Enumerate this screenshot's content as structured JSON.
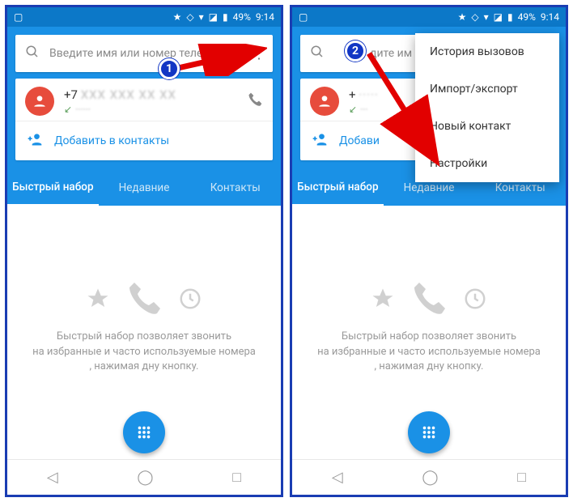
{
  "statusbar": {
    "battery": "49%",
    "time": "9:14"
  },
  "search": {
    "placeholder": "Введите имя или номер телеф",
    "placeholder_cut": "дите им"
  },
  "recent": {
    "number_prefix": "+7",
    "number_prefix2": "+",
    "number_blur": "XXX XXX XX XX",
    "incoming_mark": "↙",
    "sub_blur": "······",
    "add_label": "Добавить в контакты",
    "add_label2": "Добави"
  },
  "tabs": {
    "speed": "Быстрый набор",
    "recent": "Недавние",
    "contacts": "Контакты"
  },
  "empty": {
    "line1": "Быстрый набор позволяет звонить",
    "line2": "на избранные и часто используемые номера",
    "line3": ", нажимая                  дну кнопку."
  },
  "menu": {
    "history": "История вызовов",
    "import": "Импорт/экспорт",
    "newcontact": "Новый контакт",
    "settings": "Настройки"
  },
  "badges": {
    "b1": "1",
    "b2": "2"
  }
}
